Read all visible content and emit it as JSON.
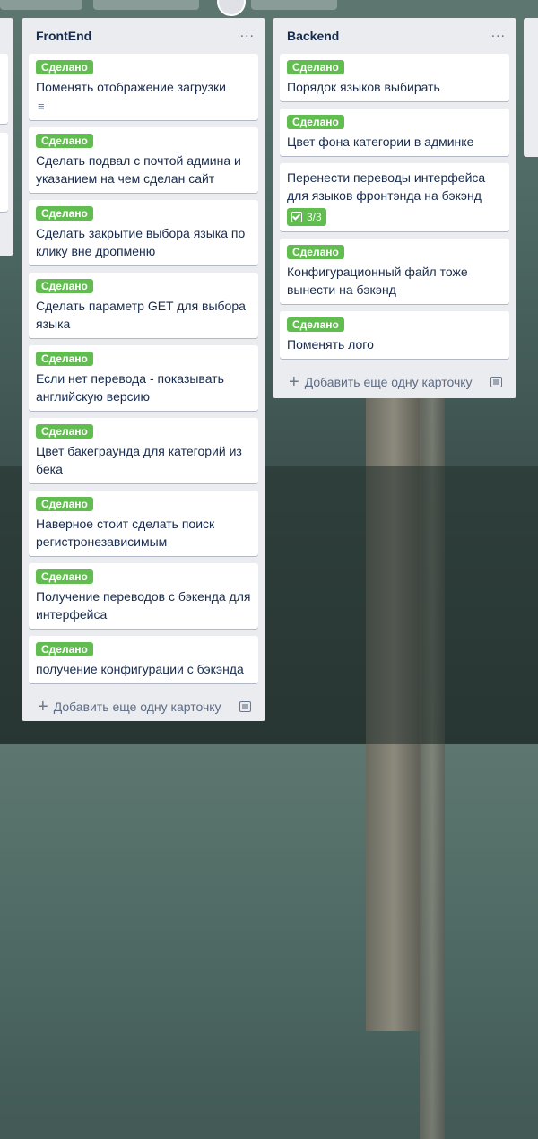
{
  "lists": {
    "frontend": {
      "title": "FrontEnd",
      "add_card": "Добавить еще одну карточку",
      "cards": [
        {
          "label": "Сделано",
          "title": "Поменять отображение загрузки"
        },
        {
          "label": "Сделано",
          "title": "Сделать подвал с почтой админа и указанием на чем сделан сайт"
        },
        {
          "label": "Сделано",
          "title": "Сделать закрытие выбора языка по клику вне дропменю"
        },
        {
          "label": "Сделано",
          "title": "Сделать параметр GET для выбора языка"
        },
        {
          "label": "Сделано",
          "title": "Если нет перевода - показывать английскую версию"
        },
        {
          "label": "Сделано",
          "title": "Цвет бакеграунда для категорий из бека"
        },
        {
          "label": "Сделано",
          "title": "Наверное стоит сделать поиск регистронезависимым"
        },
        {
          "label": "Сделано",
          "title": "Получение переводов с бэкенда для интерфейса"
        },
        {
          "label": "Сделано",
          "title": "получение конфигурации с бэкэнда"
        }
      ]
    },
    "backend": {
      "title": "Backend",
      "add_card": "Добавить еще одну карточку",
      "cards": [
        {
          "label": "Сделано",
          "title": "Порядок языков выбирать"
        },
        {
          "label": "Сделано",
          "title": "Цвет фона категории в админке"
        },
        {
          "label": "",
          "title": "Перенести переводы интерфейса для языков фронтэнда на бэкэнд",
          "checklist": "3/3"
        },
        {
          "label": "Сделано",
          "title": "Конфигурационный файл тоже вынести на бэкэнд"
        },
        {
          "label": "Сделано",
          "title": "Поменять лого"
        }
      ]
    }
  },
  "menu_glyph": "...",
  "plus_glyph": "+",
  "label_color": "#61bd4f",
  "list_bg": "#ebecf0"
}
